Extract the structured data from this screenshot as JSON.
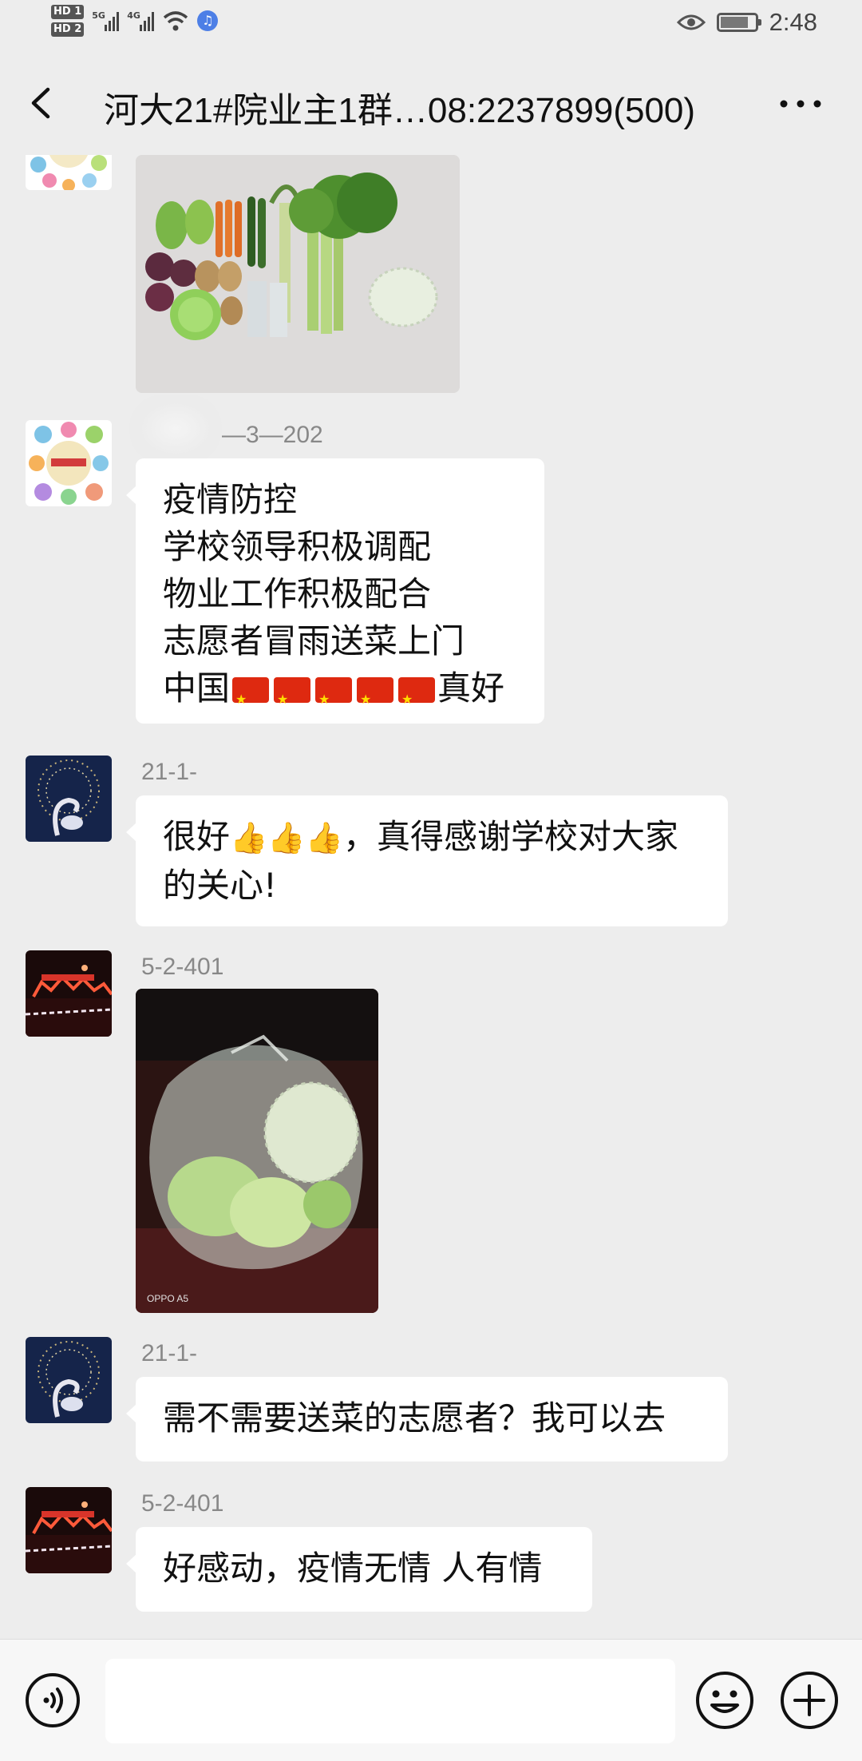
{
  "status_bar": {
    "hd1": "HD 1",
    "hd2": "HD 2",
    "net1": "5G",
    "net2": "4G",
    "time": "2:48"
  },
  "header": {
    "title": "河大21#院业主1群…08:2237899(500)"
  },
  "messages": [
    {
      "type": "image",
      "image_desc": "vegetables-on-floor"
    },
    {
      "type": "text",
      "sender": "—3—202",
      "lines": [
        "疫情防控",
        "学校领导积极调配",
        "物业工作积极配合",
        "志愿者冒雨送菜上门"
      ],
      "last_prefix": "中国",
      "last_suffix": "真好",
      "flag_count": 5
    },
    {
      "type": "text",
      "sender": "21-1-",
      "line1_prefix": "很好",
      "line1_suffix": "，真得感谢学校对大家",
      "line2": "的关心!"
    },
    {
      "type": "image",
      "sender": "5-2-401",
      "image_desc": "vegetables-in-plastic-bag",
      "watermark": "OPPO A5"
    },
    {
      "type": "text",
      "sender": "21-1-",
      "text": "需不需要送菜的志愿者？我可以去"
    },
    {
      "type": "text",
      "sender": "5-2-401",
      "text": "好感动，疫情无情 人有情"
    }
  ],
  "input_bar": {
    "placeholder": ""
  },
  "icons": [
    "back-arrow-icon",
    "more-dots-icon",
    "voice-icon",
    "emoji-icon",
    "plus-icon",
    "eye-icon",
    "battery-icon",
    "wifi-icon",
    "signal-icon",
    "bluetooth-icon"
  ],
  "colors": {
    "background": "#ededed",
    "bubble": "#ffffff",
    "flag_red": "#de2910",
    "flag_star": "#ffde00"
  }
}
